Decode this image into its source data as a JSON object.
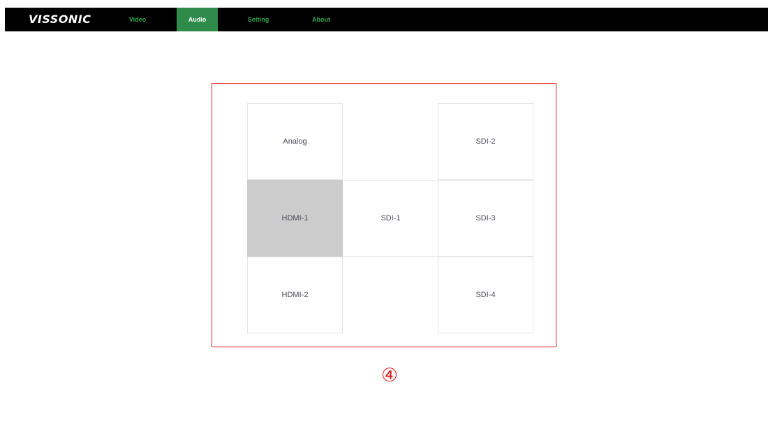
{
  "header": {
    "logo": "VISSONIC",
    "nav": [
      {
        "label": "Video",
        "active": false
      },
      {
        "label": "Audio",
        "active": true
      },
      {
        "label": "Setting",
        "active": false
      },
      {
        "label": "About",
        "active": false
      }
    ]
  },
  "audio_sources": {
    "selected": "HDMI-1",
    "cells": {
      "analog": "Analog",
      "sdi2": "SDI-2",
      "hdmi1": "HDMI-1",
      "sdi1": "SDI-1",
      "sdi3": "SDI-3",
      "hdmi2": "HDMI-2",
      "sdi4": "SDI-4"
    }
  },
  "annotation": {
    "marker": "④",
    "color": "#e02020"
  },
  "colors": {
    "topbar": "#000000",
    "accent_green": "#2e8b4a",
    "nav_text_green": "#2fa84f",
    "selected_cell": "#cccccc"
  }
}
